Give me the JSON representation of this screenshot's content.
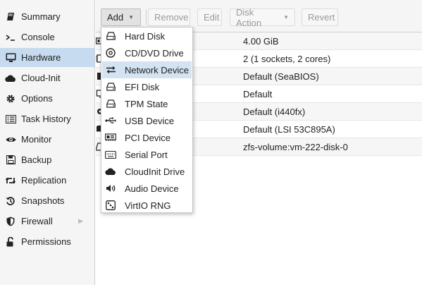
{
  "sidebar": {
    "items": [
      {
        "label": "Summary",
        "icon": "book-icon"
      },
      {
        "label": "Console",
        "icon": "terminal-icon"
      },
      {
        "label": "Hardware",
        "icon": "desktop-icon",
        "active": true
      },
      {
        "label": "Cloud-Init",
        "icon": "cloud-icon"
      },
      {
        "label": "Options",
        "icon": "gear-icon"
      },
      {
        "label": "Task History",
        "icon": "list-icon"
      },
      {
        "label": "Monitor",
        "icon": "eye-icon"
      },
      {
        "label": "Backup",
        "icon": "floppy-icon"
      },
      {
        "label": "Replication",
        "icon": "retweet-icon"
      },
      {
        "label": "Snapshots",
        "icon": "history-icon"
      },
      {
        "label": "Firewall",
        "icon": "shield-icon",
        "has_submenu": true
      },
      {
        "label": "Permissions",
        "icon": "unlock-icon"
      }
    ]
  },
  "toolbar": {
    "add_label": "Add",
    "remove_label": "Remove",
    "edit_label": "Edit",
    "disk_action_label": "Disk Action",
    "revert_label": "Revert"
  },
  "grid": {
    "rows": [
      {
        "value": "4.00 GiB"
      },
      {
        "value": "2 (1 sockets, 2 cores)"
      },
      {
        "value": "Default (SeaBIOS)"
      },
      {
        "value": "Default"
      },
      {
        "value": "Default (i440fx)"
      },
      {
        "value": "Default (LSI 53C895A)"
      },
      {
        "value": "zfs-volume:vm-222-disk-0"
      }
    ]
  },
  "add_menu": {
    "items": [
      {
        "label": "Hard Disk",
        "icon": "hdd-icon"
      },
      {
        "label": "CD/DVD Drive",
        "icon": "cdrom-icon"
      },
      {
        "label": "Network Device",
        "icon": "exchange-icon",
        "highlighted": true
      },
      {
        "label": "EFI Disk",
        "icon": "hdd-icon"
      },
      {
        "label": "TPM State",
        "icon": "hdd-icon"
      },
      {
        "label": "USB Device",
        "icon": "usb-icon"
      },
      {
        "label": "PCI Device",
        "icon": "pci-card-icon"
      },
      {
        "label": "Serial Port",
        "icon": "keyboard-icon"
      },
      {
        "label": "CloudInit Drive",
        "icon": "cloud-icon"
      },
      {
        "label": "Audio Device",
        "icon": "volume-icon"
      },
      {
        "label": "VirtIO RNG",
        "icon": "dice-icon"
      }
    ]
  }
}
